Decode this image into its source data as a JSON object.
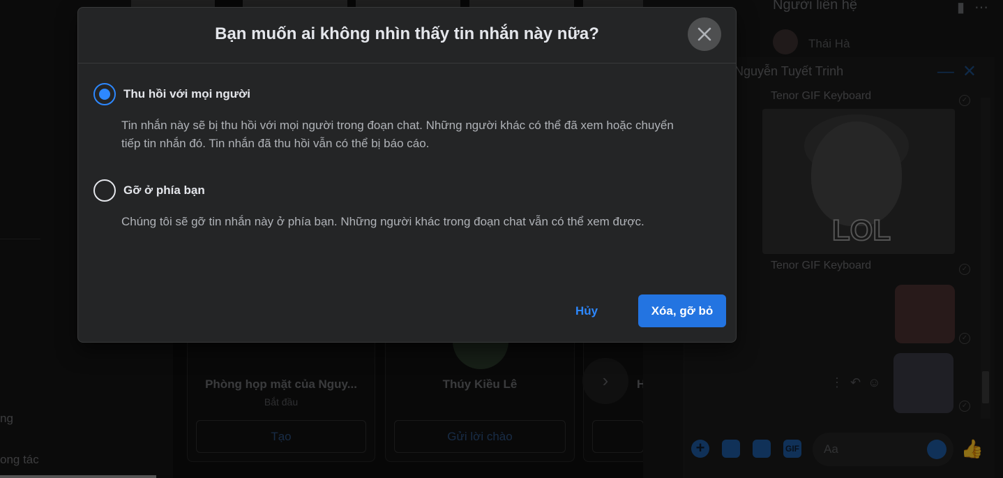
{
  "dialog": {
    "title": "Bạn muốn ai không nhìn thấy tin nhắn này nữa?",
    "options": [
      {
        "label": "Thu hồi với mọi người",
        "description": "Tin nhắn này sẽ bị thu hồi với mọi người trong đoạn chat. Những người khác có thể đã xem hoặc chuyển tiếp tin nhắn đó. Tin nhắn đã thu hồi vẫn có thể bị báo cáo.",
        "selected": true
      },
      {
        "label": "Gỡ ở phía bạn",
        "description": "Chúng tôi sẽ gỡ tin nhắn này ở phía bạn. Những người khác trong đoạn chat vẫn có thể xem được.",
        "selected": false
      }
    ],
    "cancel_label": "Hủy",
    "confirm_label": "Xóa, gỡ bỏ",
    "accent_color": "#2d88ff",
    "confirm_color": "#2374e1"
  },
  "background": {
    "left_nav": [
      "ng",
      "ong tác"
    ],
    "rooms": [
      {
        "name": "Phòng họp mặt của Nguy...",
        "subtitle": "Bắt đầu",
        "button": "Tạo"
      },
      {
        "name": "Thúy Kiều Lê",
        "subtitle": "",
        "button": "Gửi lời chào"
      },
      {
        "name": "H",
        "subtitle": "",
        "button": ""
      }
    ],
    "contacts_title": "Người liên hệ",
    "contact": "Thái Hà",
    "chat": {
      "name": "Nguyễn Tuyết Trinh",
      "gif_label": "Tenor GIF Keyboard",
      "gif_text": "LOL",
      "composer_placeholder": "Aa",
      "gif_button": "GIF"
    }
  }
}
